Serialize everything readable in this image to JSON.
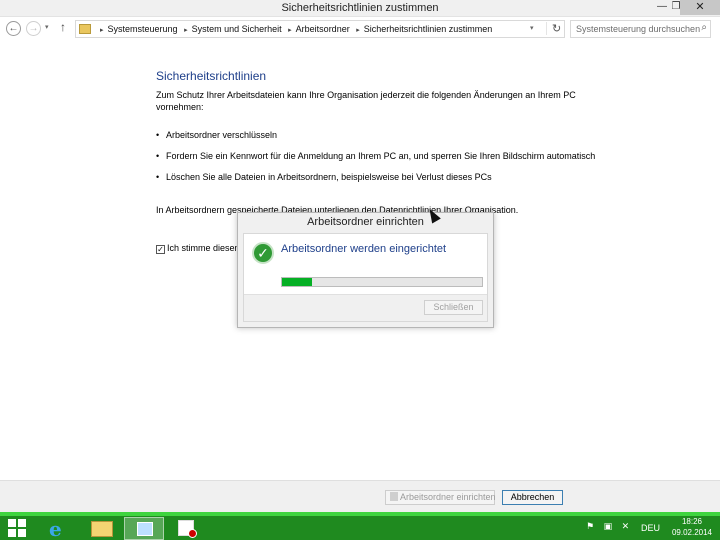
{
  "window": {
    "title": "Sicherheitsrichtlinien zustimmen",
    "minimize_glyph": "—",
    "maximize_glyph": "❐",
    "close_glyph": "✕"
  },
  "nav": {
    "back_glyph": "←",
    "forward_glyph": "→",
    "history_glyph": "▾",
    "up_glyph": "↑",
    "breadcrumbs": [
      "Systemsteuerung",
      "System und Sicherheit",
      "Arbeitsordner",
      "Sicherheitsrichtlinien zustimmen"
    ],
    "separator_glyph": "▸",
    "dropdown_glyph": "▾",
    "refresh_glyph": "↻",
    "search_placeholder": "Systemsteuerung durchsuchen",
    "search_glyph": "⌕"
  },
  "main": {
    "heading": "Sicherheitsrichtlinien",
    "intro": "Zum Schutz Ihrer Arbeitsdateien kann Ihre Organisation jederzeit die folgenden Änderungen an Ihrem PC vornehmen:",
    "bullet_glyph": "•",
    "policies": [
      "Arbeitsordner verschlüsseln",
      "Fordern Sie ein Kennwort für die Anmeldung an Ihrem PC an, und sperren Sie Ihren Bildschirm automatisch",
      "Löschen Sie alle Dateien in Arbeitsordnern, beispielsweise bei Verlust dieses PCs"
    ],
    "note": "In Arbeitsordnern gespeicherte Dateien unterliegen den Datenrichtlinien Ihrer Organisation.",
    "agree_label": "Ich stimme diesen",
    "agree_checked": true,
    "checkbox_glyph": "✓"
  },
  "dialog": {
    "title": "Arbeitsordner einrichten",
    "message": "Arbeitsordner werden eingerichtet",
    "check_glyph": "✓",
    "progress_percent": 15,
    "close_button": "Schließen",
    "close_enabled": false
  },
  "commands": {
    "setup_button": "Arbeitsordner einrichten",
    "setup_enabled": false,
    "cancel_button": "Abbrechen"
  },
  "taskbar": {
    "ie_glyph": "e",
    "tray_icons": [
      "flag-icon",
      "network-icon",
      "volume-muted-icon"
    ],
    "tray_glyphs": [
      "⚑",
      "▣",
      "✕"
    ],
    "language": "DEU",
    "time": "18:26",
    "date": "09.02.2014"
  },
  "colors": {
    "heading": "#1e3f8a",
    "taskbar": "#1f8a1f",
    "progress": "#06b025"
  }
}
